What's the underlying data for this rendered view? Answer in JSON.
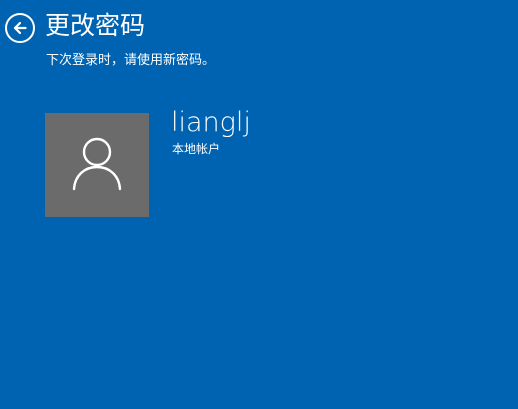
{
  "header": {
    "title": "更改密码",
    "subtitle": "下次登录时，请使用新密码。",
    "back_icon": "arrow-left-circle-icon"
  },
  "account": {
    "username": "lianglj",
    "type": "本地帐户",
    "avatar_icon": "user-silhouette-icon"
  },
  "colors": {
    "background": "#0063b1",
    "avatar_background": "#6b6b6b",
    "text": "#ffffff"
  }
}
